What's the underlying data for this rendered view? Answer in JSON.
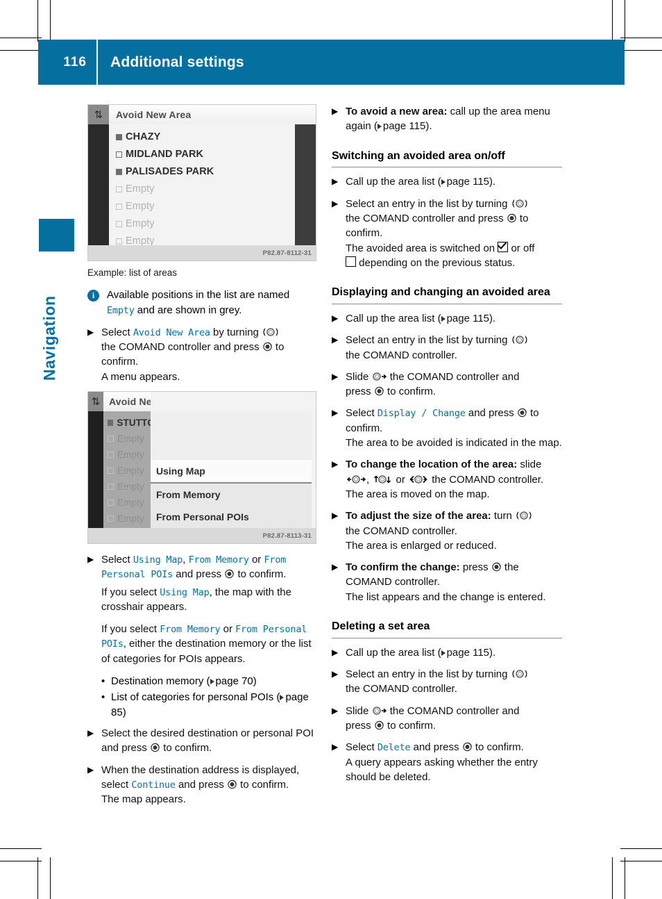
{
  "header": {
    "page_number": "116",
    "title": "Additional settings",
    "accent_color": "#0570a0"
  },
  "chapter_tab": {
    "label": "Navigation"
  },
  "figures": {
    "fig1": {
      "caption": "Example: list of areas",
      "title": "Avoid New Area",
      "back_icon": "back-arrow-icon",
      "rows": [
        {
          "label": "CHAZY",
          "marker": "filled",
          "empty": false
        },
        {
          "label": "MIDLAND PARK",
          "marker": "hollow",
          "empty": false
        },
        {
          "label": "PALISADES PARK",
          "marker": "filled",
          "empty": false
        },
        {
          "label": "Empty",
          "marker": "hollow",
          "empty": true
        },
        {
          "label": "Empty",
          "marker": "hollow",
          "empty": true
        },
        {
          "label": "Empty",
          "marker": "hollow",
          "empty": true
        },
        {
          "label": "Empty",
          "marker": "hollow",
          "empty": true
        }
      ],
      "code": "P82.87-8112-31"
    },
    "fig2": {
      "title": "Avoid Ne",
      "back_icon": "back-arrow-icon",
      "rows": [
        {
          "label": "STUTTG",
          "marker": "filled",
          "empty": false
        },
        {
          "label": "Empty",
          "marker": "hollow",
          "empty": true
        },
        {
          "label": "Empty",
          "marker": "hollow",
          "empty": true
        },
        {
          "label": "Empty",
          "marker": "hollow",
          "empty": true
        },
        {
          "label": "Empty",
          "marker": "hollow",
          "empty": true
        },
        {
          "label": "Empty",
          "marker": "hollow",
          "empty": true
        },
        {
          "label": "Empty",
          "marker": "hollow",
          "empty": true
        }
      ],
      "menu": [
        {
          "label": "Using Map",
          "selected": true
        },
        {
          "label": "From Memory",
          "selected": false
        },
        {
          "label": "From Personal POIs",
          "selected": false
        }
      ],
      "code": "P82.87-8113-31"
    }
  },
  "left_column": {
    "note_available": {
      "icon": "info-icon",
      "text_before": "Available positions in the list are named ",
      "mono": "Empty",
      "text_after": " and are shown in grey."
    },
    "step_select_avoid": {
      "lead": "Select ",
      "mono": "Avoid New Area",
      "mid": " by turning ",
      "glyph_turn": "comand-turn-icon",
      "line2": "the COMAND controller and press ",
      "glyph_press": "comand-press-icon",
      "line2_end": " to",
      "line3": "confirm.",
      "result": "A menu appears."
    },
    "step_select_source": {
      "lead": "Select ",
      "mono1": "Using Map",
      "sep1": ", ",
      "mono2": "From Memory",
      "sep2": " or ",
      "mono3": "From Personal POIs",
      "tail": " and press ",
      "glyph_press": "comand-press-icon",
      "tail2": " to confirm.",
      "para_if1_before": "If you select ",
      "para_if1_mono": "Using Map",
      "para_if1_after": ", the map with the crosshair appears.",
      "para_if2_before": "If you select ",
      "para_if2_mono1": "From Memory",
      "para_if2_mid": " or ",
      "para_if2_mono2": "From Personal POIs",
      "para_if2_after": ", either the destination memory or the list of categories for POIs appears."
    },
    "bullets": [
      {
        "text": "Destination memory (",
        "page_ref": "page 70",
        "tail": ")"
      },
      {
        "text": "List of categories for personal POIs (",
        "page_ref": "page 85",
        "tail": ")"
      }
    ],
    "step_select_dest": {
      "line1": "Select the desired destination or personal",
      "line2": "POI and press ",
      "glyph_press": "comand-press-icon",
      "line2_end": " to confirm."
    },
    "step_continue": {
      "line1": "When the destination address is displayed,",
      "line2_before": "select ",
      "mono": "Continue",
      "line2_after": " and press ",
      "glyph_press": "comand-press-icon",
      "line2_end": " to confirm.",
      "result": "The map appears."
    }
  },
  "right_column": {
    "step_avoid_new": {
      "bold": "To avoid a new area:",
      "text": " call up the area menu again (",
      "page_ref": "page 115",
      "tail": ")."
    },
    "section_switching": {
      "heading": "Switching an avoided area on/off",
      "step1": {
        "text": "Call up the area list (",
        "page_ref": "page 115",
        "tail": ")."
      },
      "step2": {
        "lead": "Select an entry in the list by turning ",
        "glyph_turn": "comand-turn-icon",
        "line2": "the COMAND controller and press ",
        "glyph_press": "comand-press-icon",
        "line2_end": " to",
        "line3": "confirm.",
        "result_before": "The avoided area is switched on ",
        "result_checked": "checkbox-checked-icon",
        "result_mid": " or off ",
        "result_unchecked": "checkbox-unchecked-icon",
        "result_after": " depending on the previous status."
      }
    },
    "section_display": {
      "heading": "Displaying and changing an avoided area",
      "step1": {
        "text": "Call up the area list (",
        "page_ref": "page 115",
        "tail": ")."
      },
      "step2": {
        "lead": "Select an entry in the list by turning ",
        "glyph_turn": "comand-turn-icon",
        "line2": "the COMAND controller."
      },
      "step3": {
        "lead": "Slide ",
        "glyph_slide": "comand-slide-right-icon",
        "mid": " the COMAND controller and",
        "line2": "press ",
        "glyph_press": "comand-press-icon",
        "line2_end": " to confirm."
      },
      "step4": {
        "lead": "Select ",
        "mono": "Display / Change",
        "mid": " and press ",
        "glyph_press": "comand-press-icon",
        "tail": " to",
        "line2": "confirm.",
        "result": "The area to be avoided is indicated in the map."
      },
      "step5": {
        "bold": "To change the location of the area:",
        "text": " slide ",
        "glyph_lr": "comand-slide-horizontal-icon",
        "sep1": ", ",
        "glyph_ud": "comand-slide-vertical-icon",
        "sep2": " or ",
        "glyph_diag": "comand-slide-diagonal-icon",
        "tail": " the COMAND controller.",
        "result": "The area is moved on the map."
      },
      "step6": {
        "bold": "To adjust the size of the area:",
        "text": " turn ",
        "glyph_turn": "comand-turn-icon",
        "line2": "the COMAND controller.",
        "result": "The area is enlarged or reduced."
      },
      "step7": {
        "bold": "To confirm the change:",
        "text": " press ",
        "glyph_press": "comand-press-icon",
        "tail": " the",
        "line2": "COMAND controller.",
        "result": "The list appears and the change is entered."
      }
    },
    "section_deleting": {
      "heading": "Deleting a set area",
      "step1": {
        "text": "Call up the area list (",
        "page_ref": "page 115",
        "tail": ")."
      },
      "step2": {
        "lead": "Select an entry in the list by turning ",
        "glyph_turn": "comand-turn-icon",
        "line2": "the COMAND controller."
      },
      "step3": {
        "lead": "Slide ",
        "glyph_slide": "comand-slide-right-icon",
        "mid": " the COMAND controller and",
        "line2": "press ",
        "glyph_press": "comand-press-icon",
        "line2_end": " to confirm."
      },
      "step4": {
        "lead": "Select ",
        "mono": "Delete",
        "mid": " and press ",
        "glyph_press": "comand-press-icon",
        "tail": " to confirm.",
        "result": "A query appears asking whether the entry should be deleted."
      }
    }
  }
}
